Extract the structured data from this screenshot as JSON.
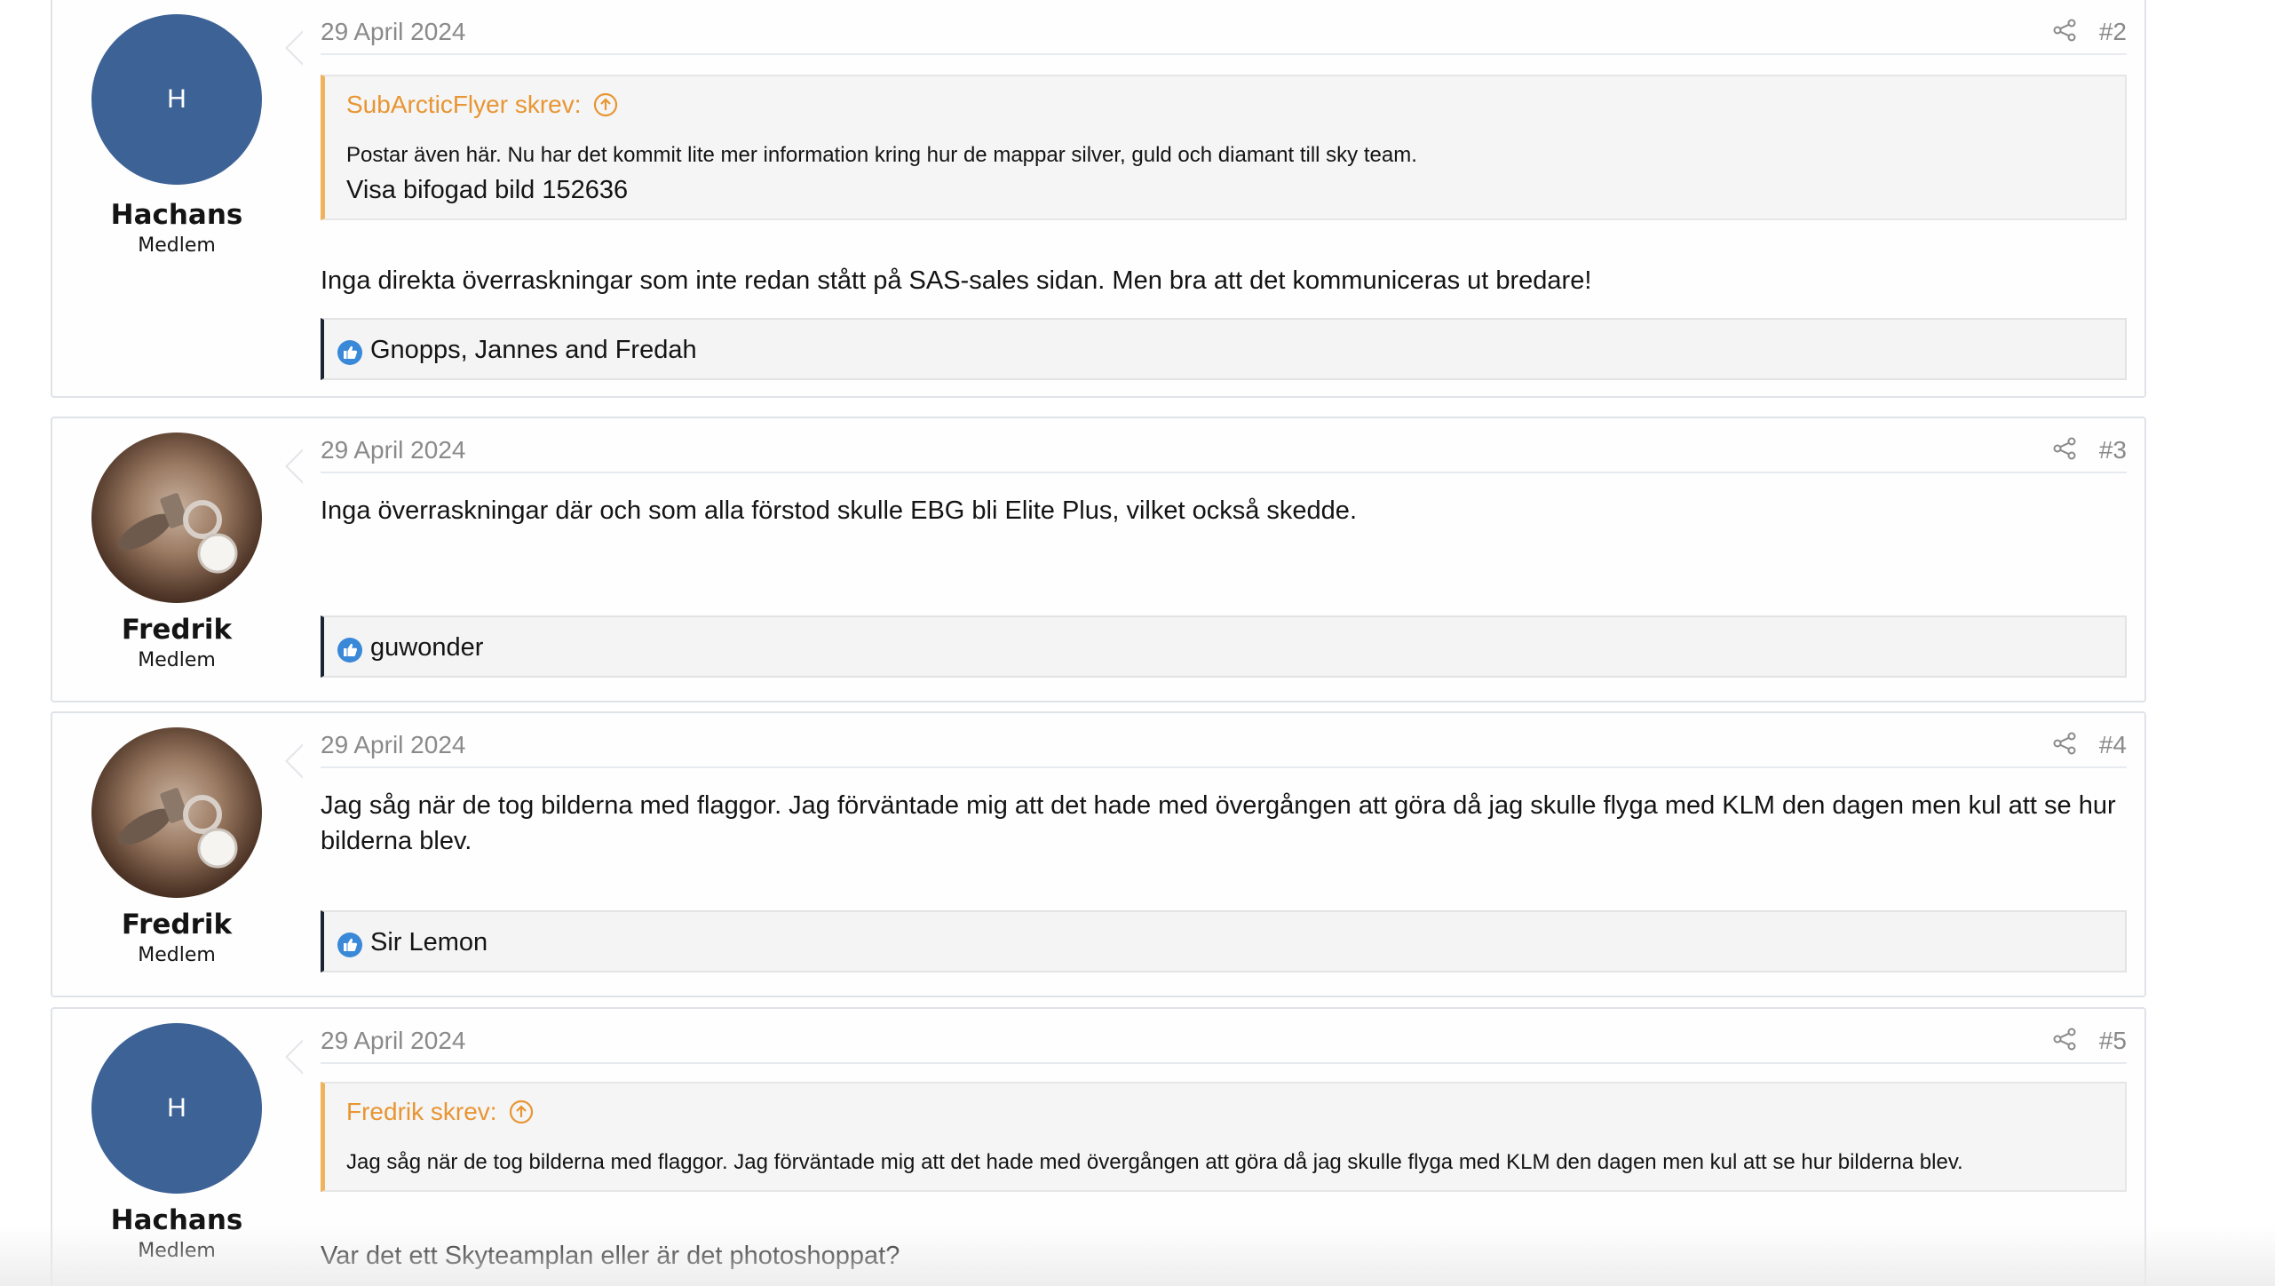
{
  "posts": [
    {
      "avatar_letter": "H",
      "username": "Hachans",
      "user_title": "Medlem",
      "date": "29 April 2024",
      "number": "#2",
      "quote": {
        "author": "SubArcticFlyer skrev:",
        "text": "Postar även här. Nu har det kommit lite mer information kring hur de mappar silver, guld och diamant till sky team.",
        "attachment": "Visa bifogad bild 152636"
      },
      "message": "Inga direkta överraskningar som inte redan stått på SAS-sales sidan. Men bra att det kommuniceras ut bredare!",
      "reactions": "Gnopps, Jannes and Fredah"
    },
    {
      "username": "Fredrik",
      "user_title": "Medlem",
      "date": "29 April 2024",
      "number": "#3",
      "message": "Inga överraskningar där och som alla förstod skulle EBG bli Elite Plus, vilket också skedde.",
      "reactions": "guwonder"
    },
    {
      "username": "Fredrik",
      "user_title": "Medlem",
      "date": "29 April 2024",
      "number": "#4",
      "message": "Jag såg när de tog bilderna med flaggor. Jag förväntade mig att det hade med övergången att göra då jag skulle flyga med KLM den dagen men kul att se hur bilderna blev.",
      "reactions": "Sir Lemon"
    },
    {
      "avatar_letter": "H",
      "username": "Hachans",
      "user_title": "Medlem",
      "date": "29 April 2024",
      "number": "#5",
      "quote": {
        "author": "Fredrik skrev:",
        "text": "Jag såg när de tog bilderna med flaggor. Jag förväntade mig att det hade med övergången att göra då jag skulle flyga med KLM den dagen men kul att se hur bilderna blev."
      },
      "message": "Var det ett Skyteamplan eller är det photoshoppat?"
    }
  ],
  "icons": {
    "share": "share-icon",
    "quote_up": "arrow-up-circle-icon",
    "like": "thumbs-up-icon"
  },
  "colors": {
    "avatar_bg": "#3d6296",
    "quote_accent": "#f0b35b",
    "quote_author": "#e89532",
    "like_icon": "#3a88d8"
  }
}
